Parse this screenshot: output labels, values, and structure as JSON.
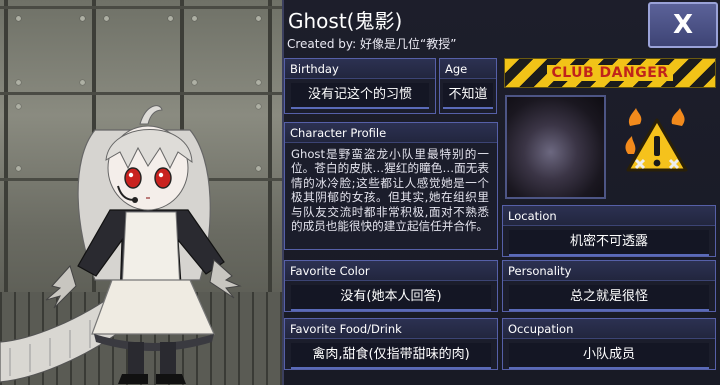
{
  "profile": {
    "name": "Ghost(鬼影)",
    "created_by": "Created by: 好像是几位“教授”",
    "close_label": "X",
    "danger_banner": "CLUB DANGER",
    "fields": {
      "birthday": {
        "label": "Birthday",
        "value": "没有记这个的习惯"
      },
      "age": {
        "label": "Age",
        "value": "不知道"
      },
      "character_profile": {
        "label": "Character Profile",
        "text": "Ghost是野蛮盗龙小队里最特别的一位。苍白的皮肤…猩红的瞳色…面无表情的冰冷脸;这些都让人感觉她是一个极其阴郁的女孩。但其实,她在组织里与队友交流时都非常积极,面对不熟悉的成员也能很快的建立起信任并合作。"
      },
      "location": {
        "label": "Location",
        "value": "机密不可透露"
      },
      "favorite_color": {
        "label": "Favorite Color",
        "value": "没有(她本人回答)"
      },
      "personality": {
        "label": "Personality",
        "value": "总之就是很怪"
      },
      "favorite_food": {
        "label": "Favorite Food/Drink",
        "value": "禽肉,甜食(仅指带甜味的肉)"
      },
      "occupation": {
        "label": "Occupation",
        "value": "小队成员"
      }
    }
  }
}
